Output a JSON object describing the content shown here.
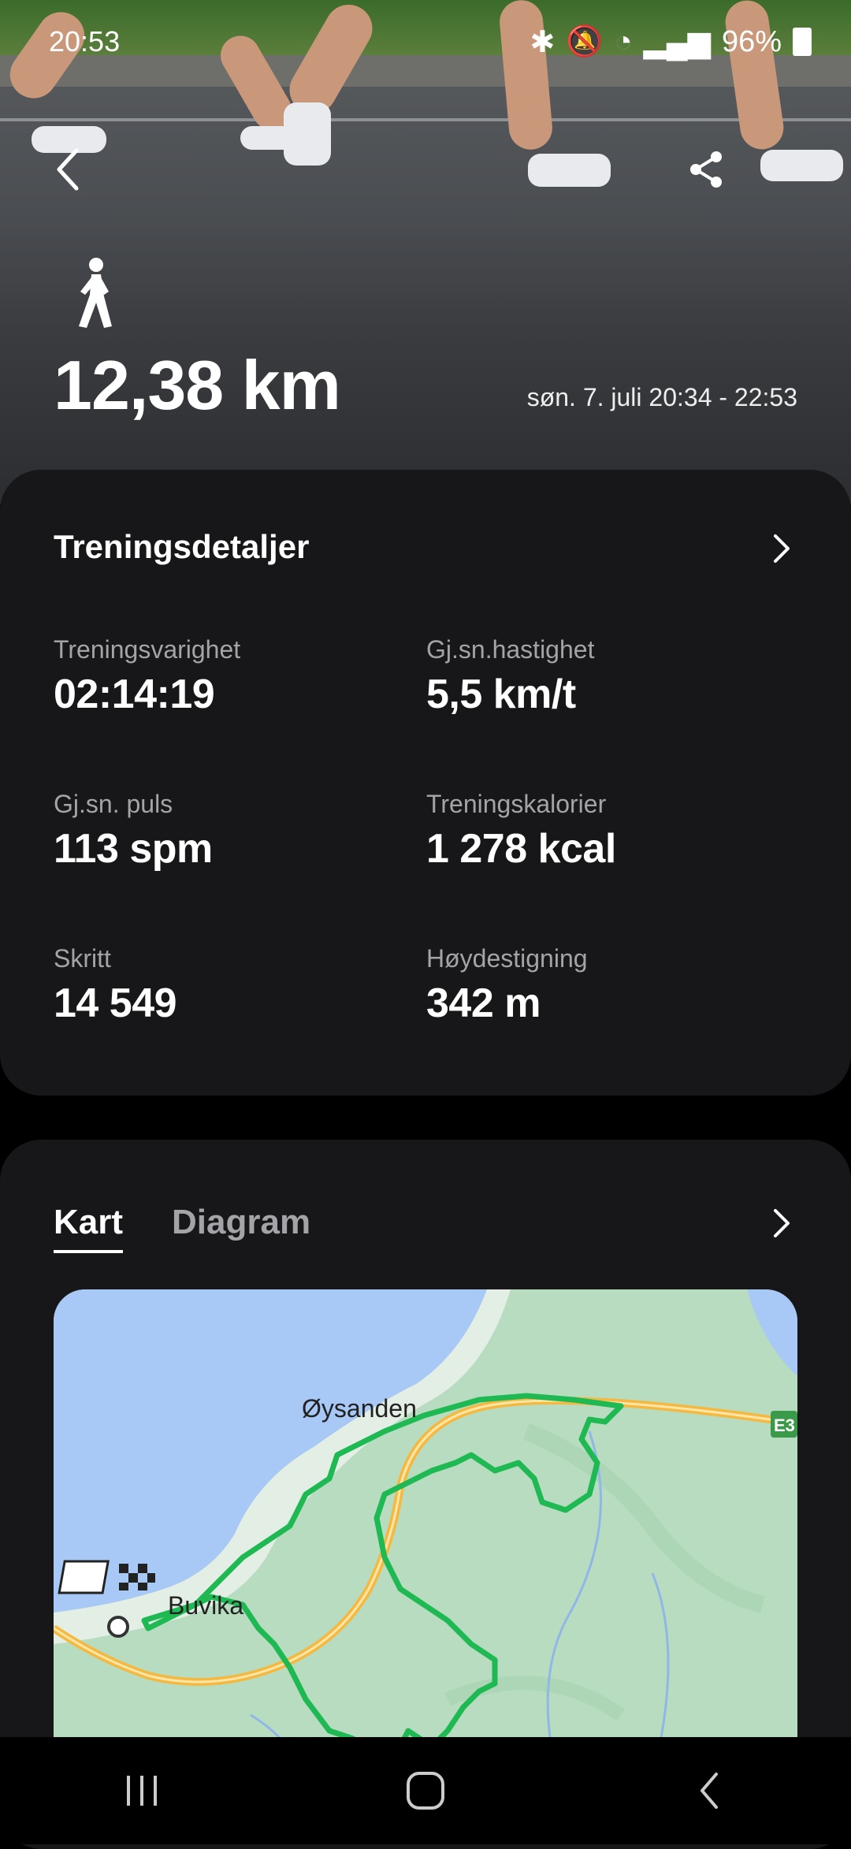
{
  "status_bar": {
    "time": "20:53",
    "battery": "96%",
    "icons": [
      "bluetooth-icon",
      "mute-icon",
      "wifi-icon",
      "signal-icon",
      "battery-icon"
    ]
  },
  "header": {
    "activity_icon": "walking-icon",
    "distance": "12,38 km",
    "date_range": "søn. 7. juli 20:34 - 22:53",
    "back_icon": "back-arrow-icon",
    "share_icon": "share-icon"
  },
  "details": {
    "title": "Treningsdetaljer",
    "stats": [
      {
        "label": "Treningsvarighet",
        "value": "02:14:19"
      },
      {
        "label": "Gj.sn.hastighet",
        "value": "5,5 km/t"
      },
      {
        "label": "Gj.sn. puls",
        "value": "113 spm"
      },
      {
        "label": "Treningskalorier",
        "value": "1 278 kcal"
      },
      {
        "label": "Skritt",
        "value": "14 549"
      },
      {
        "label": "Høydestigning",
        "value": "342 m"
      }
    ]
  },
  "map_section": {
    "tabs": [
      "Kart",
      "Diagram"
    ],
    "active_tab": "Kart",
    "map_labels": {
      "place1": "Øysanden",
      "place2": "Buvika",
      "road": "E3"
    }
  },
  "colors": {
    "route": "#1fb954",
    "road": "#f5b840",
    "water": "#a8c8f5",
    "land": "#b7dcbf",
    "card": "#171719"
  }
}
